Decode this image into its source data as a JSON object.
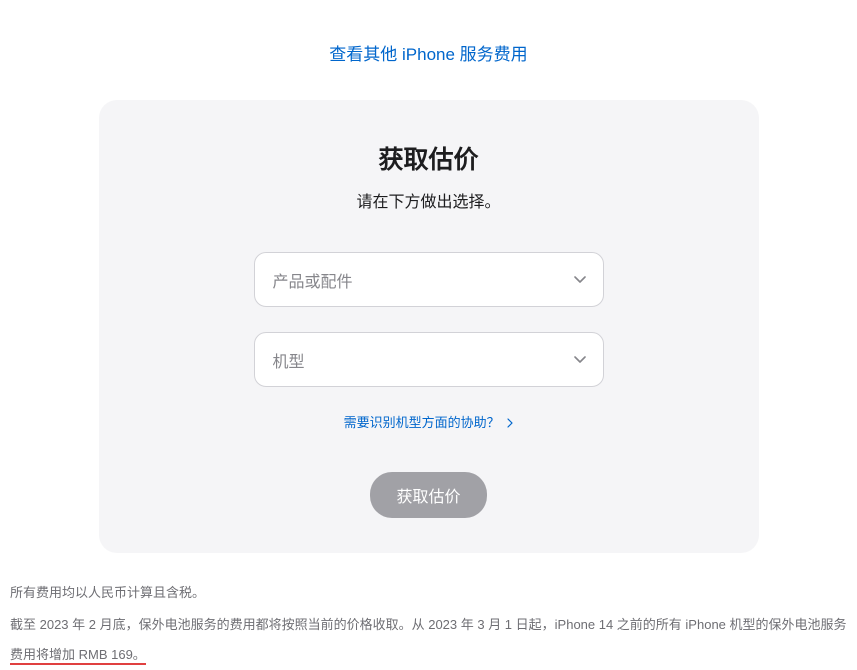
{
  "topLink": {
    "label": "查看其他 iPhone 服务费用"
  },
  "card": {
    "title": "获取估价",
    "subtitle": "请在下方做出选择。",
    "select1": {
      "placeholder": "产品或配件"
    },
    "select2": {
      "placeholder": "机型"
    },
    "helpLink": {
      "label": "需要识别机型方面的协助？"
    },
    "button": {
      "label": "获取估价"
    }
  },
  "footer": {
    "line1": "所有费用均以人民币计算且含税。",
    "line2_part1": "截至 2023 年 2 月底，保外电池服务的费用都将按照当前的价格收取。从 2023 年 3 月 1 日起，iPhone 14 之前的所有 iPhone 机型的保外电池服务",
    "line2_highlight": "费用将增加 RMB 169。"
  }
}
